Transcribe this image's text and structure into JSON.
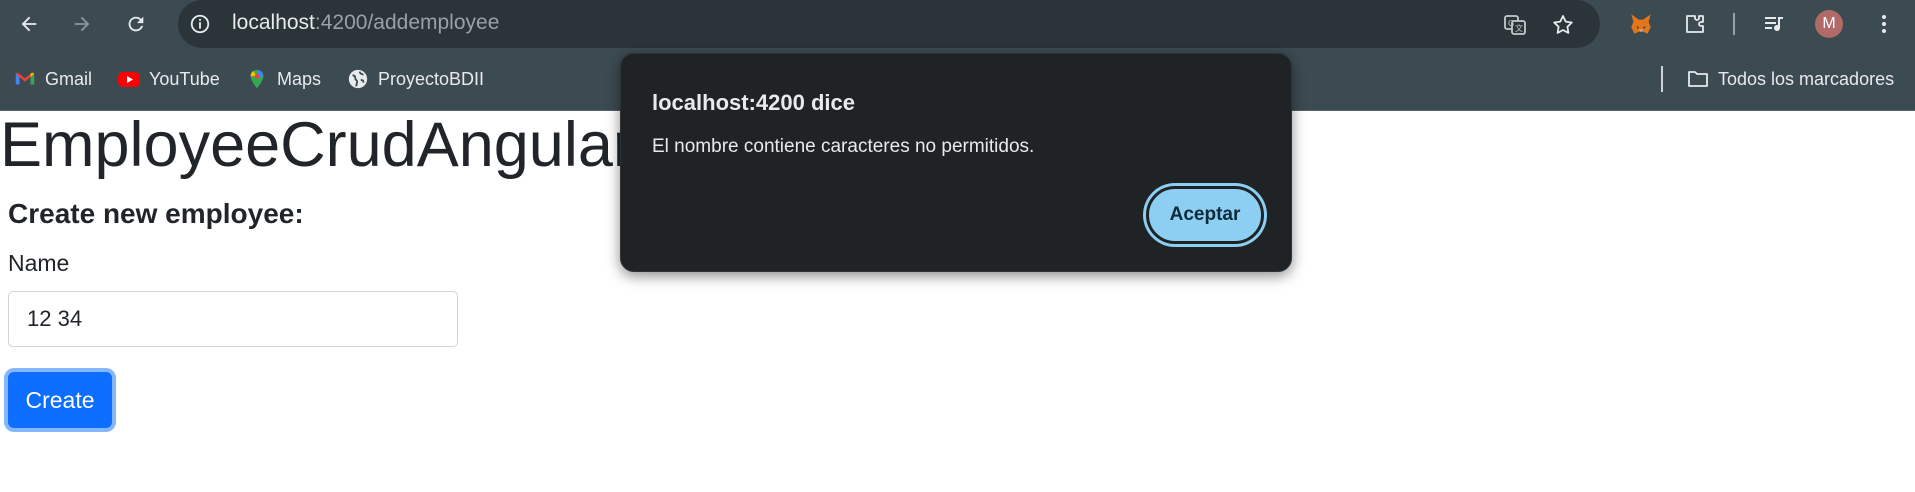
{
  "browser": {
    "url_host": "localhost",
    "url_path": ":4200/addemployee",
    "avatar_letter": "M",
    "icons": {
      "back": "back-arrow-icon",
      "forward": "forward-arrow-icon",
      "reload": "reload-icon",
      "site_info": "site-info-icon",
      "translate": "translate-icon",
      "bookmark": "star-icon",
      "extension_fox": "metamask-fox-icon",
      "extensions": "puzzle-icon",
      "media": "media-control-icon",
      "menu": "kebab-menu-icon"
    }
  },
  "bookmarks": {
    "items": [
      {
        "label": "Gmail",
        "icon": "gmail-icon"
      },
      {
        "label": "YouTube",
        "icon": "youtube-icon"
      },
      {
        "label": "Maps",
        "icon": "maps-icon"
      },
      {
        "label": "ProyectoBDII",
        "icon": "globe-icon"
      }
    ],
    "all_bookmarks": "Todos los marcadores"
  },
  "page": {
    "app_title": "EmployeeCrudAngular",
    "section_title": "Create new employee:",
    "name_label": "Name",
    "name_value": "12 34",
    "create_label": "Create"
  },
  "dialog": {
    "title": "localhost:4200 dice",
    "message": "El nombre contiene caracteres no permitidos.",
    "accept_label": "Aceptar"
  },
  "colors": {
    "chrome_bg": "#3c4a52",
    "omnibox_bg": "#2b3439",
    "primary_button": "#0d6efd",
    "dialog_bg": "#1f2326",
    "dialog_button": "#8ccff2"
  }
}
